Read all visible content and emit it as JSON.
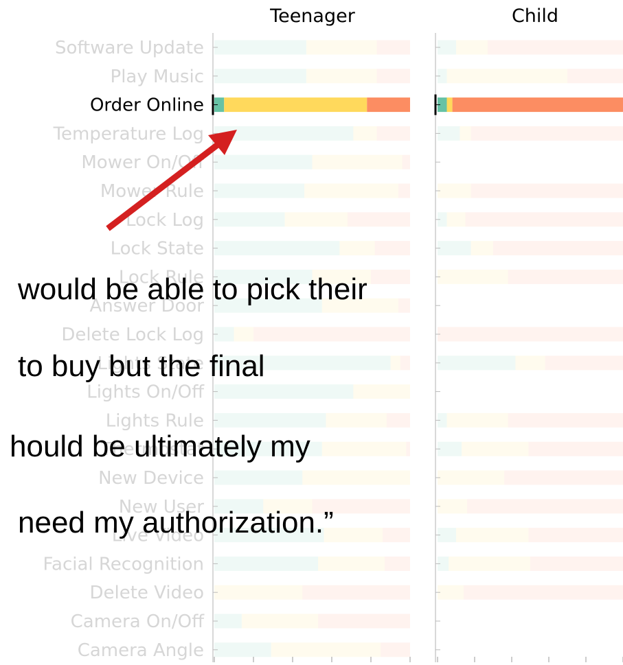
{
  "chart_data": {
    "type": "bar",
    "stacked": true,
    "orientation": "horizontal",
    "panels": [
      "Teenager",
      "Child"
    ],
    "categories": [
      "Software Update",
      "Play Music",
      "Order Online",
      "Temperature Log",
      "Mower On/Off",
      "Mower Rule",
      "Lock Log",
      "Lock State",
      "Lock Rule",
      "Answer Door",
      "Delete Lock Log",
      "Lights State",
      "Lights On/Off",
      "Lights Rule",
      "Thermostat",
      "New Device",
      "New User",
      "Live Video",
      "Facial Recognition",
      "Delete Video",
      "Camera On/Off",
      "Camera Angle"
    ],
    "highlighted_category": "Order Online",
    "xlim": [
      0,
      1
    ],
    "series_colors": [
      "#66c2a5",
      "#ffd95c",
      "#fc8d62"
    ],
    "teenager": [
      [
        0.47,
        0.36,
        0.17
      ],
      [
        0.47,
        0.36,
        0.17
      ],
      [
        0.05,
        0.73,
        0.22
      ],
      [
        0.71,
        0.12,
        0.17
      ],
      [
        0.5,
        0.46,
        0.04
      ],
      [
        0.46,
        0.48,
        0.06
      ],
      [
        0.36,
        0.32,
        0.32
      ],
      [
        0.64,
        0.18,
        0.18
      ],
      [
        0.5,
        0.3,
        0.2
      ],
      [
        0.55,
        0.39,
        0.06
      ],
      [
        0.1,
        0.1,
        0.8
      ],
      [
        0.9,
        0.05,
        0.05
      ],
      [
        0.71,
        0.29,
        0.0
      ],
      [
        0.57,
        0.31,
        0.12
      ],
      [
        0.55,
        0.43,
        0.02
      ],
      [
        0.45,
        0.55,
        0.0
      ],
      [
        0.25,
        0.25,
        0.5
      ],
      [
        0.56,
        0.3,
        0.14
      ],
      [
        0.53,
        0.34,
        0.13
      ],
      [
        0.0,
        0.45,
        0.55
      ],
      [
        0.14,
        0.39,
        0.47
      ],
      [
        0.29,
        0.56,
        0.15
      ]
    ],
    "child": [
      [
        0.1,
        0.17,
        0.73
      ],
      [
        0.05,
        0.65,
        0.3
      ],
      [
        0.05,
        0.03,
        0.92
      ],
      [
        0.12,
        0.06,
        0.82
      ],
      [
        0.0,
        0.0,
        0.0
      ],
      [
        0.0,
        0.18,
        0.82
      ],
      [
        0.05,
        0.1,
        0.85
      ],
      [
        0.18,
        0.12,
        0.7
      ],
      [
        0.0,
        0.38,
        0.62
      ],
      [
        0.0,
        0.0,
        0.0
      ],
      [
        0.0,
        0.0,
        1.0
      ],
      [
        0.42,
        0.16,
        0.42
      ],
      [
        0.0,
        0.0,
        0.0
      ],
      [
        0.05,
        0.33,
        0.62
      ],
      [
        0.13,
        0.36,
        0.51
      ],
      [
        0.0,
        0.36,
        0.64
      ],
      [
        0.0,
        0.16,
        0.84
      ],
      [
        0.1,
        0.39,
        0.51
      ],
      [
        0.06,
        0.44,
        0.5
      ],
      [
        0.0,
        0.14,
        0.86
      ],
      [
        0.0,
        0.0,
        0.0
      ],
      [
        0.0,
        0.0,
        0.0
      ]
    ]
  },
  "quote": {
    "line1": "would be able to pick their",
    "line2": "to buy but the final",
    "line3": "hould be ultimately my",
    "line4": "need my authorization.”"
  },
  "annotation": {
    "arrow_color": "#d42020"
  }
}
